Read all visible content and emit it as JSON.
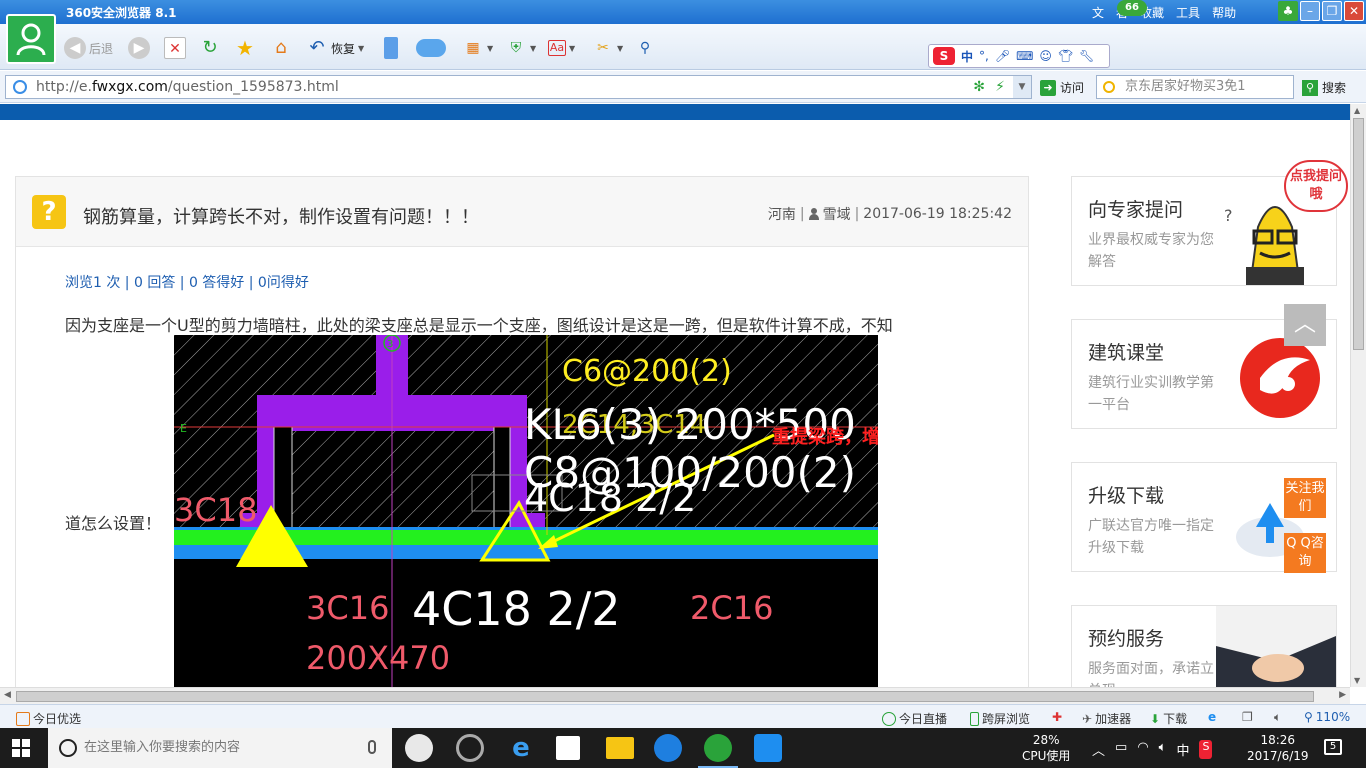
{
  "browser": {
    "title": "360安全浏览器 8.1",
    "menu": [
      "文",
      "看",
      "收藏",
      "工具",
      "帮助"
    ],
    "badge": "66",
    "toolbar": {
      "back": "后退",
      "restore": "恢复"
    },
    "ime": {
      "logo": "S",
      "mode": "中"
    },
    "address": {
      "scheme": "http://e.",
      "host": "fwxgx.com",
      "path": "/question_1595873.html"
    },
    "go_label": "访问",
    "search_placeholder": "京东居家好物买3免1",
    "search_label": "搜索"
  },
  "question": {
    "title": "钢筋算量，计算跨长不对，制作设置有问题！！！",
    "region": "河南",
    "user": "雪域",
    "datetime": "2017-06-19 18:25:42",
    "stats": "浏览1 次 | 0 回答 | 0 答得好 | 0问得好",
    "body_line1": "因为支座是一个U型的剪力墙暗柱，此处的梁支座总是显示一个支座，图纸设计是这是一跨，但是软件计算不成，不知",
    "body_line2": "道怎么设置！"
  },
  "cad": {
    "text_c6": "C6@200(2)",
    "text_kl6": "KL6(3) 200*500",
    "text_c8": "C8@100/200(2)",
    "text_4c18_top": "4C18 2/2",
    "text_2c14": "2C14;3C14",
    "text_3c18": "3C18",
    "annotation": "重提梁跨，增加支座",
    "text_3c16": "3C16",
    "text_4c18_bottom": "4C18 2/2",
    "text_2c16": "2C16",
    "text_size": "200X470",
    "grid_e": "E",
    "grid_3": "3"
  },
  "sidebar": {
    "bubble": "点我提问哦",
    "cards": [
      {
        "title": "向专家提问",
        "desc": "业界最权威专家为您解答"
      },
      {
        "title": "建筑课堂",
        "desc": "建筑行业实训教学第一平台"
      },
      {
        "title": "升级下载",
        "desc": "广联达官方唯一指定升级下载"
      },
      {
        "title": "预约服务",
        "desc": "服务面对面，承诺立兑现"
      }
    ],
    "follow": "关注我们",
    "qq": "Q Q咨询"
  },
  "statusbar": {
    "today": "今日优选",
    "live": "今日直播",
    "cross": "跨屏浏览",
    "accel": "加速器",
    "download": "下载",
    "zoom": "110%"
  },
  "taskbar": {
    "search_placeholder": "在这里输入你要搜索的内容",
    "cpu_percent": "28%",
    "cpu_label": "CPU使用",
    "ime": "中",
    "time": "18:26",
    "date": "2017/6/19",
    "notifications": "5"
  },
  "colors": {
    "brand_blue": "#0b5cad",
    "accent_orange": "#f47a20",
    "question_yellow": "#f6c514"
  }
}
